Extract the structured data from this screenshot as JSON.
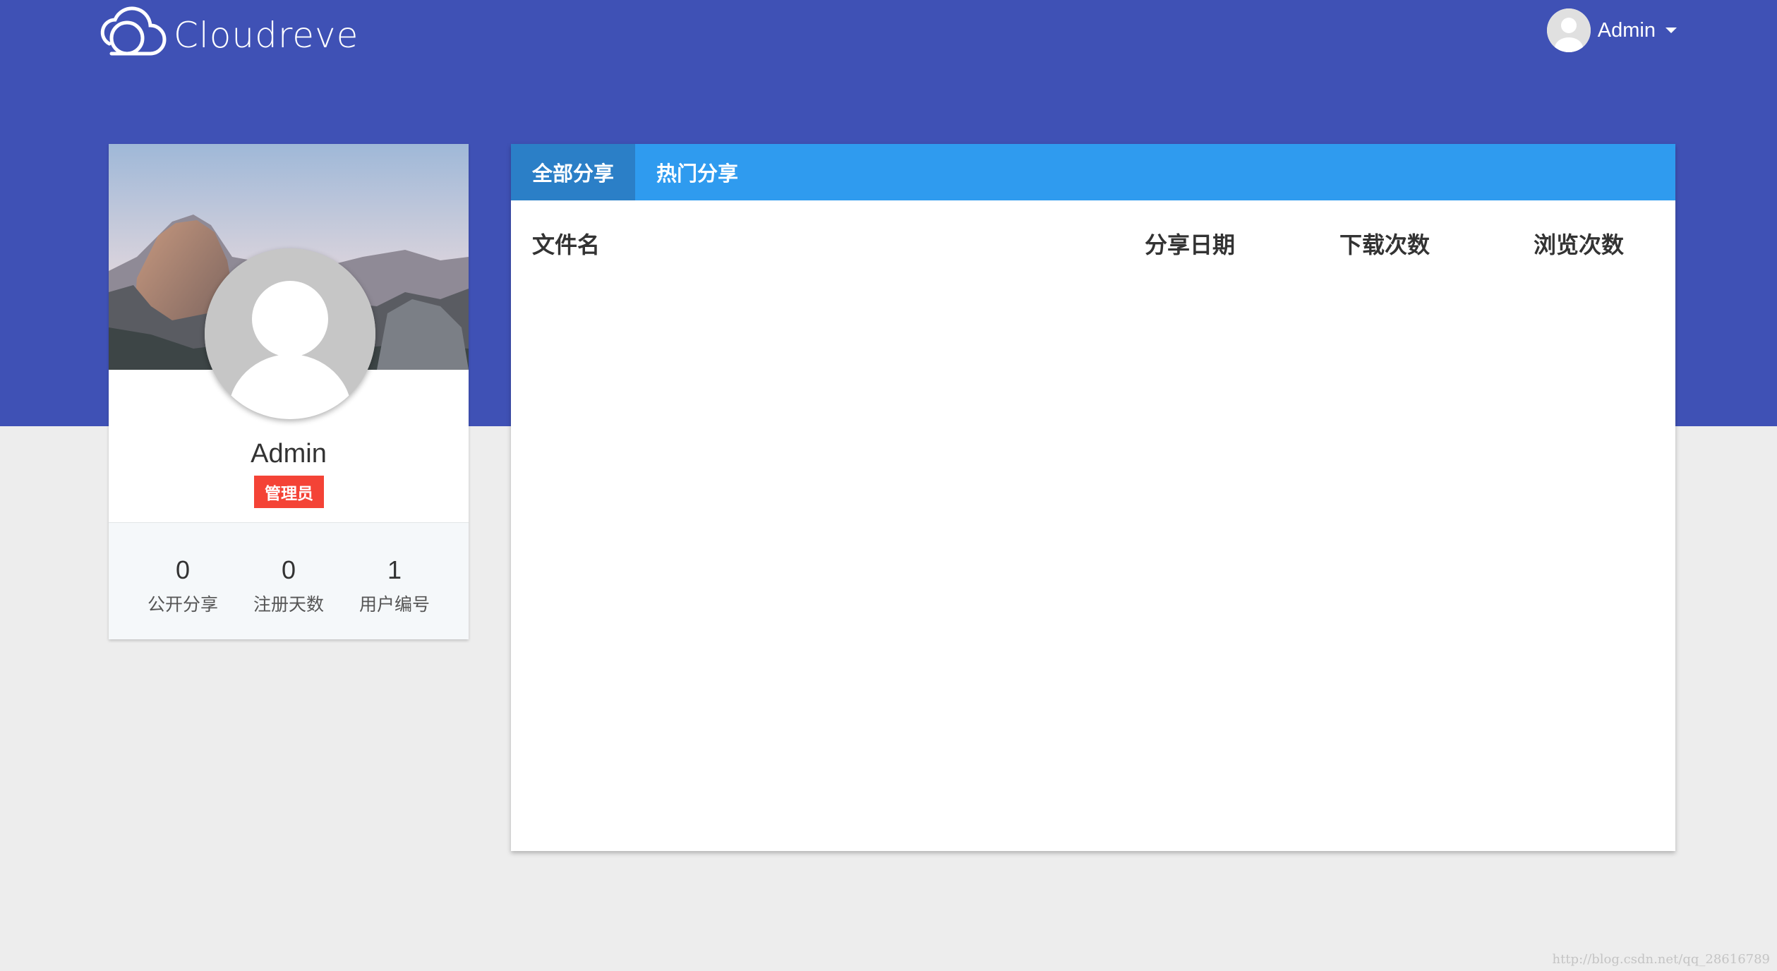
{
  "brand": {
    "name": "Cloudreve"
  },
  "user_menu": {
    "name": "Admin"
  },
  "profile": {
    "name": "Admin",
    "role_badge": "管理员",
    "stats": [
      {
        "value": "0",
        "label": "公开分享"
      },
      {
        "value": "0",
        "label": "注册天数"
      },
      {
        "value": "1",
        "label": "用户编号"
      }
    ]
  },
  "shares": {
    "tabs": [
      {
        "label": "全部分享",
        "active": true
      },
      {
        "label": "热门分享",
        "active": false
      }
    ],
    "columns": {
      "filename": "文件名",
      "share_date": "分享日期",
      "downloads": "下载次数",
      "views": "浏览次数"
    },
    "rows": []
  },
  "watermark": "http://blog.csdn.net/qq_28616789",
  "colors": {
    "header": "#3f51b5",
    "tab_bar": "#2f9bef",
    "tab_active": "#2b7fc7",
    "badge": "#f44336"
  }
}
